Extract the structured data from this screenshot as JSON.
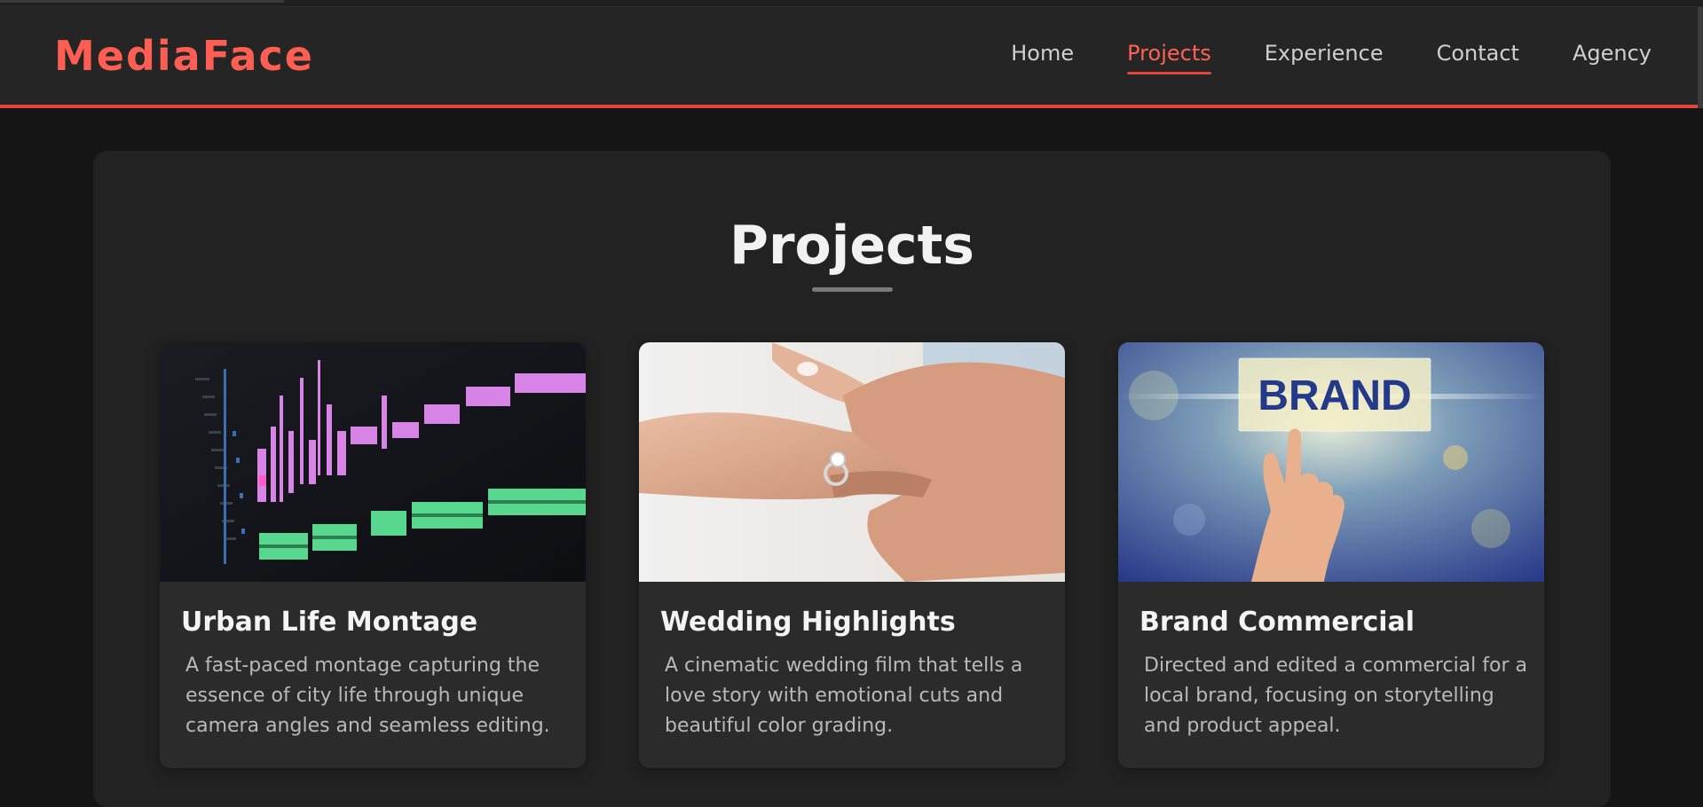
{
  "site": {
    "brand": "MediaFace",
    "accent_color": "#e2453c"
  },
  "nav": {
    "items": [
      {
        "label": "Home",
        "active": false
      },
      {
        "label": "Projects",
        "active": true
      },
      {
        "label": "Experience",
        "active": false
      },
      {
        "label": "Contact",
        "active": false
      },
      {
        "label": "Agency",
        "active": false
      }
    ]
  },
  "projects": {
    "title": "Projects",
    "cards": [
      {
        "title": "Urban Life Montage",
        "description": "A fast-paced montage capturing the essence of city life through unique camera angles and seamless editing.",
        "image": "video-editing-timeline"
      },
      {
        "title": "Wedding Highlights",
        "description": "A cinematic wedding film that tells a love story with emotional cuts and beautiful color grading.",
        "image": "wedding-ring-hands"
      },
      {
        "title": "Brand Commercial",
        "description": "Directed and edited a commercial for a local brand, focusing on storytelling and product appeal.",
        "image": "hand-touching-brand-sign",
        "image_text": "BRAND"
      }
    ]
  }
}
